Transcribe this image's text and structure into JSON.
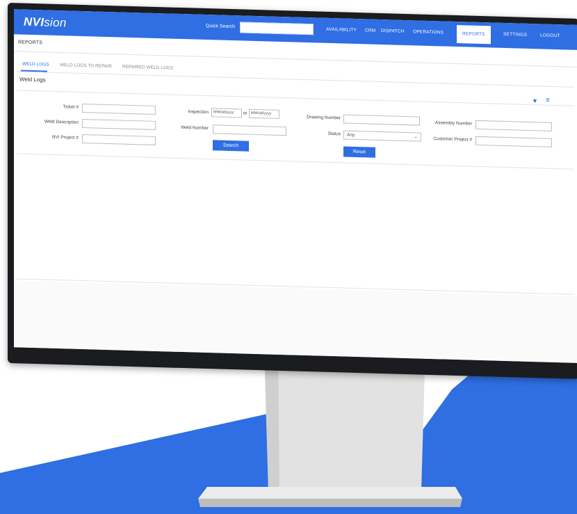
{
  "colors": {
    "brand": "#2f6ee3",
    "bezel": "#1a1c1f",
    "stand": "#dcdcdc"
  },
  "app": {
    "logo_main": "NVI",
    "logo_rest": "sion"
  },
  "nav": {
    "quick_search_label": "Quick Search",
    "quick_search_value": "",
    "items": [
      {
        "label": "AVAILABILITY"
      },
      {
        "label": "CRM"
      },
      {
        "label": "DISPATCH"
      },
      {
        "label": "OPERATIONS"
      },
      {
        "label": "REPORTS",
        "active": true
      },
      {
        "label": "SETTINGS"
      },
      {
        "label": "LOGOUT"
      }
    ]
  },
  "page": {
    "title": "REPORTS"
  },
  "tabs": [
    {
      "label": "WELD LOGS",
      "active": true
    },
    {
      "label": "WELD LOGS TO REPAIR"
    },
    {
      "label": "REPAIRED WELD LOGS"
    }
  ],
  "section": {
    "title": "Weld Logs"
  },
  "icons": {
    "filter": "filter-icon",
    "menu": "menu-icon"
  },
  "filters": {
    "ticket_label": "Ticket #",
    "weld_description_label": "Weld Description",
    "nvi_project_label": "NVI Project #",
    "inspection_label": "Inspection",
    "inspection_from_placeholder": "MM/dd/yyyy",
    "inspection_to_label": "to",
    "inspection_to_placeholder": "MM/dd/yyyy",
    "weld_number_label": "Weld Number",
    "drawing_number_label": "Drawing Number",
    "status_label": "Status",
    "status_value": "Any",
    "assembly_number_label": "Assembly Number",
    "customer_project_label": "Customer Project #",
    "search_button": "Search",
    "reset_button": "Reset"
  }
}
